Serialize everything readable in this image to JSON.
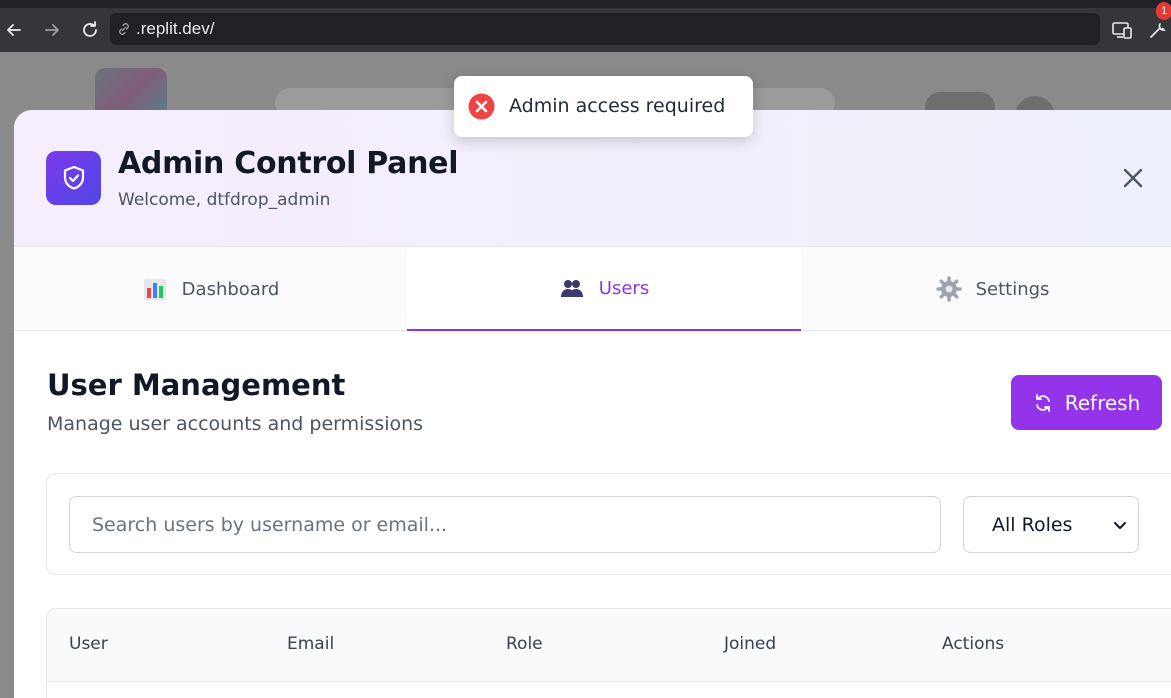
{
  "browser": {
    "url": ".replit.dev/",
    "extension_badge": "1"
  },
  "toast": {
    "message": "Admin access required",
    "icon": "error-circle-icon",
    "color": "#ef4444"
  },
  "modal": {
    "title": "Admin Control Panel",
    "subtitle": "Welcome, dtfdrop_admin",
    "icon": "shield-check-icon",
    "accent": "#9333ea"
  },
  "tabs": [
    {
      "label": "Dashboard",
      "icon": "bar-chart-icon",
      "active": false
    },
    {
      "label": "Users",
      "icon": "users-icon",
      "active": true
    },
    {
      "label": "Settings",
      "icon": "gear-icon",
      "active": false
    }
  ],
  "users_section": {
    "title": "User Management",
    "subtitle": "Manage user accounts and permissions",
    "refresh_label": "Refresh",
    "search_placeholder": "Search users by username or email...",
    "role_filter_value": "All Roles"
  },
  "table": {
    "columns": [
      "User",
      "Email",
      "Role",
      "Joined",
      "Actions"
    ]
  }
}
